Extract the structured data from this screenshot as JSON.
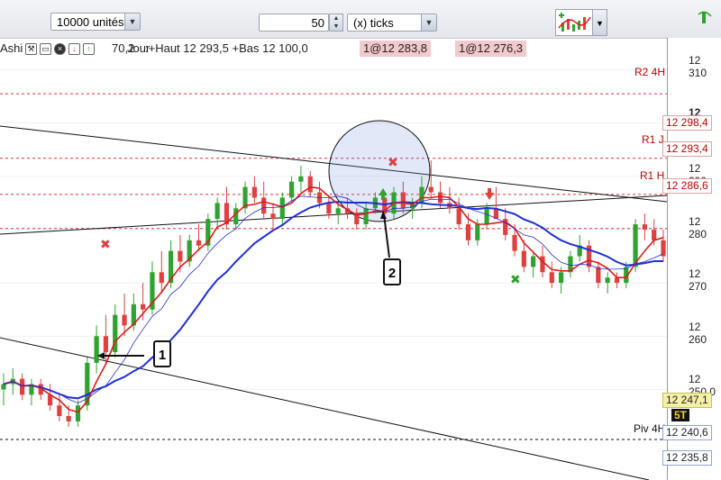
{
  "toolbar": {
    "units_value": "10000 unités",
    "ticks_value": "50",
    "ticks_unit": "(x) ticks"
  },
  "info": {
    "mode_label": "Ashi",
    "text_frag": "70,2",
    "text_frag2": "Jour",
    "text_main": ":+Haut 12 293,5 +Bas 12 100,0"
  },
  "orders": [
    {
      "label": "1@12 283,8"
    },
    {
      "label": "1@12 276,3"
    }
  ],
  "axis": {
    "ticks": [
      "12 310",
      "12 300",
      "12 290",
      "12 280",
      "12 270",
      "12 260",
      "12 250,0"
    ],
    "labels": {
      "r2_4h_price": "12 298,4",
      "r1j_price": "12 293,4",
      "r1h_price": "12 286,6",
      "r1h4_price": "12 280",
      "current_price": "12 247,1",
      "piv4h_price": "12 240,6",
      "bottom_price": "12 235,8",
      "badge": "5T"
    }
  },
  "levels": {
    "r2_4h": "R2 4H",
    "r1_j": "R1 J",
    "r1_h": "R1 H",
    "piv_4h": "Piv 4H"
  },
  "callouts": [
    "1",
    "2"
  ],
  "colors": {
    "bull": "#2fa32f",
    "bear": "#e04040",
    "ma_blue": "#1f2fd6",
    "ma_red": "#e01a1a",
    "level": "#e03030"
  },
  "chart_data": {
    "type": "candlestick",
    "ylim": [
      12233,
      12316
    ],
    "levels": [
      {
        "name": "R2 4H",
        "value": 12305.5
      },
      {
        "name": "R1 J",
        "value": 12293.4
      },
      {
        "name": "R1 H",
        "value": 12286.6
      },
      {
        "name": "",
        "value": 12280.2
      },
      {
        "name": "Piv 4H",
        "value": 12240.6
      }
    ],
    "ohlc": [
      [
        12250,
        12253,
        12247,
        12251
      ],
      [
        12251,
        12254,
        12249,
        12252
      ],
      [
        12252,
        12253,
        12248,
        12249
      ],
      [
        12249,
        12252,
        12247,
        12251
      ],
      [
        12251,
        12252,
        12248,
        12249
      ],
      [
        12249,
        12251,
        12246,
        12247
      ],
      [
        12247,
        12249,
        12244,
        12245
      ],
      [
        12245,
        12247,
        12243,
        12244
      ],
      [
        12244,
        12248,
        12243,
        12247
      ],
      [
        12247,
        12256,
        12246,
        12255
      ],
      [
        12255,
        12262,
        12253,
        12260
      ],
      [
        12260,
        12264,
        12255,
        12257
      ],
      [
        12257,
        12266,
        12256,
        12264
      ],
      [
        12264,
        12268,
        12260,
        12262
      ],
      [
        12262,
        12268,
        12261,
        12266
      ],
      [
        12266,
        12270,
        12263,
        12265
      ],
      [
        12265,
        12274,
        12264,
        12272
      ],
      [
        12272,
        12276,
        12268,
        12270
      ],
      [
        12270,
        12278,
        12269,
        12276
      ],
      [
        12276,
        12279,
        12272,
        12274
      ],
      [
        12274,
        12279,
        12273,
        12278
      ],
      [
        12278,
        12281,
        12276,
        12277
      ],
      [
        12277,
        12283,
        12276,
        12282
      ],
      [
        12282,
        12286,
        12280,
        12285
      ],
      [
        12285,
        12288,
        12280,
        12281
      ],
      [
        12281,
        12285,
        12280,
        12284
      ],
      [
        12284,
        12289,
        12283,
        12288
      ],
      [
        12288,
        12290,
        12285,
        12286
      ],
      [
        12286,
        12289,
        12282,
        12283
      ],
      [
        12283,
        12285,
        12280,
        12282
      ],
      [
        12282,
        12287,
        12281,
        12286
      ],
      [
        12286,
        12290,
        12285,
        12289
      ],
      [
        12289,
        12292,
        12287,
        12290
      ],
      [
        12290,
        12291,
        12286,
        12287
      ],
      [
        12287,
        12289,
        12284,
        12285
      ],
      [
        12285,
        12286,
        12282,
        12283
      ],
      [
        12283,
        12285,
        12281,
        12284
      ],
      [
        12284,
        12286,
        12282,
        12283
      ],
      [
        12283,
        12284,
        12280,
        12281
      ],
      [
        12281,
        12285,
        12280,
        12284
      ],
      [
        12284,
        12287,
        12283,
        12286
      ],
      [
        12286,
        12287,
        12282,
        12283
      ],
      [
        12283,
        12288,
        12282,
        12287
      ],
      [
        12287,
        12289,
        12283,
        12284
      ],
      [
        12284,
        12286,
        12282,
        12285
      ],
      [
        12285,
        12290,
        12284,
        12288
      ],
      [
        12288,
        12293,
        12286,
        12287
      ],
      [
        12287,
        12289,
        12284,
        12285
      ],
      [
        12285,
        12288,
        12283,
        12284
      ],
      [
        12284,
        12286,
        12280,
        12281
      ],
      [
        12281,
        12283,
        12277,
        12278
      ],
      [
        12278,
        12282,
        12277,
        12281
      ],
      [
        12281,
        12285,
        12280,
        12284
      ],
      [
        12284,
        12288,
        12283,
        12282
      ],
      [
        12282,
        12284,
        12278,
        12279
      ],
      [
        12279,
        12281,
        12275,
        12276
      ],
      [
        12276,
        12278,
        12272,
        12273
      ],
      [
        12273,
        12276,
        12271,
        12275
      ],
      [
        12275,
        12277,
        12271,
        12272
      ],
      [
        12272,
        12274,
        12269,
        12270
      ],
      [
        12270,
        12273,
        12268,
        12272
      ],
      [
        12272,
        12276,
        12271,
        12275
      ],
      [
        12275,
        12279,
        12274,
        12277
      ],
      [
        12277,
        12278,
        12272,
        12273
      ],
      [
        12273,
        12274,
        12269,
        12270
      ],
      [
        12270,
        12272,
        12268,
        12271
      ],
      [
        12271,
        12272,
        12269,
        12270
      ],
      [
        12270,
        12274,
        12269,
        12273
      ],
      [
        12273,
        12282,
        12272,
        12281
      ],
      [
        12281,
        12283,
        12278,
        12280
      ],
      [
        12280,
        12282,
        12277,
        12278
      ],
      [
        12278,
        12280,
        12274,
        12275
      ]
    ],
    "series": [
      {
        "values_ref": "ma_fast"
      },
      {
        "values_ref": "ma_slow"
      }
    ],
    "annotations": [
      {
        "label": "1",
        "kind": "callout"
      },
      {
        "label": "2",
        "kind": "callout"
      }
    ]
  }
}
